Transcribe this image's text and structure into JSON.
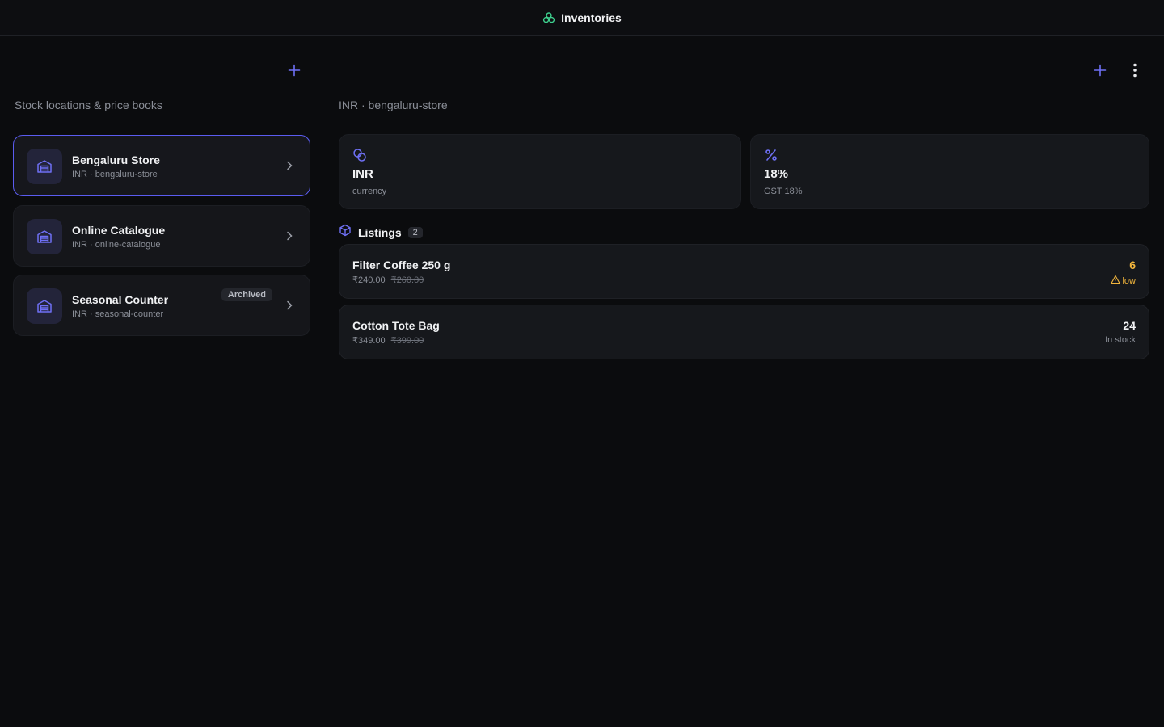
{
  "app": {
    "title": "Inventories",
    "accent": "#5b5cf0",
    "brand_color": "#3ecf8e",
    "warning_color": "#f0b43c"
  },
  "sidebar": {
    "subtitle": "Stock locations & price books",
    "add_icon": "plus-icon",
    "locations": [
      {
        "name": "Bengaluru Store",
        "meta": "INR · bengaluru-store",
        "badge": "",
        "active": true,
        "icon": "warehouse-icon"
      },
      {
        "name": "Online Catalogue",
        "meta": "INR · online-catalogue",
        "badge": "",
        "active": false,
        "icon": "warehouse-icon"
      },
      {
        "name": "Seasonal Counter",
        "meta": "INR · seasonal-counter",
        "badge": "Archived",
        "active": false,
        "icon": "warehouse-icon"
      }
    ]
  },
  "main": {
    "subtitle": "INR · bengaluru-store",
    "stats": [
      {
        "value": "INR",
        "label": "currency",
        "icon": "coins-icon"
      },
      {
        "value": "18%",
        "label": "GST 18%",
        "icon": "percent-icon"
      }
    ],
    "listings": {
      "title": "Listings",
      "count": "2",
      "icon": "box-icon",
      "items": [
        {
          "name": "Filter Coffee 250 g",
          "price": "₹240.00",
          "mrp": "₹260.00",
          "qty": "6",
          "status": "low",
          "low": true
        },
        {
          "name": "Cotton Tote Bag",
          "price": "₹349.00",
          "mrp": "₹399.00",
          "qty": "24",
          "status": "In stock",
          "low": false
        }
      ]
    }
  }
}
